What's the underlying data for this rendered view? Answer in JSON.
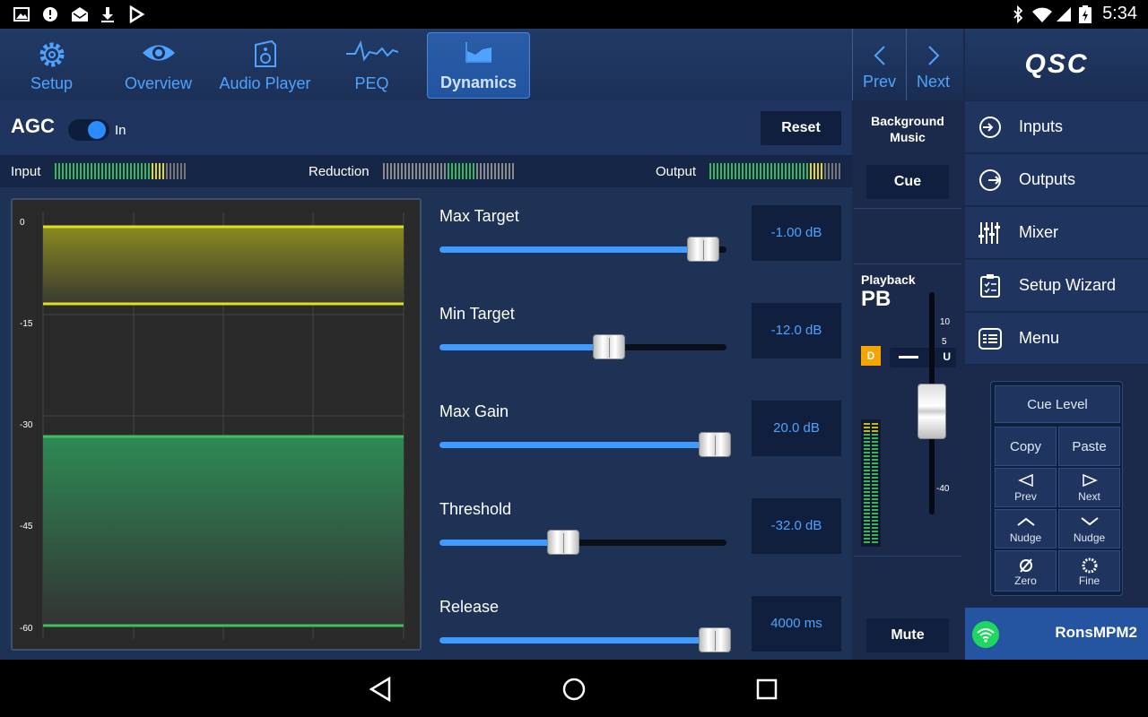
{
  "status": {
    "time": "5:34"
  },
  "tabs": [
    {
      "label": "Setup",
      "icon": "gear-icon"
    },
    {
      "label": "Overview",
      "icon": "eye-icon"
    },
    {
      "label": "Audio Player",
      "icon": "speaker-icon"
    },
    {
      "label": "PEQ",
      "icon": "eq-curve-icon"
    },
    {
      "label": "Dynamics",
      "icon": "dynamics-icon",
      "active": true
    }
  ],
  "prev_label": "Prev",
  "next_label": "Next",
  "agc": {
    "title": "AGC",
    "toggle_label": "In",
    "toggle_on": true,
    "reset_label": "Reset"
  },
  "meters": {
    "input_label": "Input",
    "reduction_label": "Reduction",
    "output_label": "Output"
  },
  "graph": {
    "y_labels": [
      "0",
      "-15",
      "-30",
      "-45",
      "-60"
    ]
  },
  "sliders": [
    {
      "label": "Max Target",
      "value": "-1.00 dB",
      "fraction": 0.92
    },
    {
      "label": "Min Target",
      "value": "-12.0 dB",
      "fraction": 0.59
    },
    {
      "label": "Max Gain",
      "value": "20.0 dB",
      "fraction": 0.96
    },
    {
      "label": "Threshold",
      "value": "-32.0 dB",
      "fraction": 0.43
    },
    {
      "label": "Release",
      "value": "4000 ms",
      "fraction": 0.96
    }
  ],
  "strip": {
    "zone_name": "Background Music",
    "cue_label": "Cue",
    "source_label": "Playback",
    "source_name": "PB",
    "d_badge": "D",
    "u_badge": "U",
    "fader_ticks": [
      "10",
      "5",
      "-40"
    ],
    "mute_label": "Mute"
  },
  "rightnav": {
    "logo": "QSC",
    "items": [
      {
        "label": "Inputs",
        "icon": "input-icon"
      },
      {
        "label": "Outputs",
        "icon": "output-icon"
      },
      {
        "label": "Mixer",
        "icon": "mixer-icon"
      },
      {
        "label": "Setup Wizard",
        "icon": "clipboard-icon"
      },
      {
        "label": "Menu",
        "icon": "menu-icon"
      }
    ],
    "cue_level": "Cue Level",
    "copy": "Copy",
    "paste": "Paste",
    "prev": "Prev",
    "next": "Next",
    "nudge_up": "Nudge",
    "nudge_down": "Nudge",
    "zero": "Zero",
    "fine": "Fine",
    "device_name": "RonsMPM2"
  },
  "colors": {
    "accent": "#4fa3ff",
    "active_tab": "#2254a0",
    "yellow_band": "#e0e020",
    "green_band": "#3cc060",
    "d_badge": "#f5a400"
  }
}
